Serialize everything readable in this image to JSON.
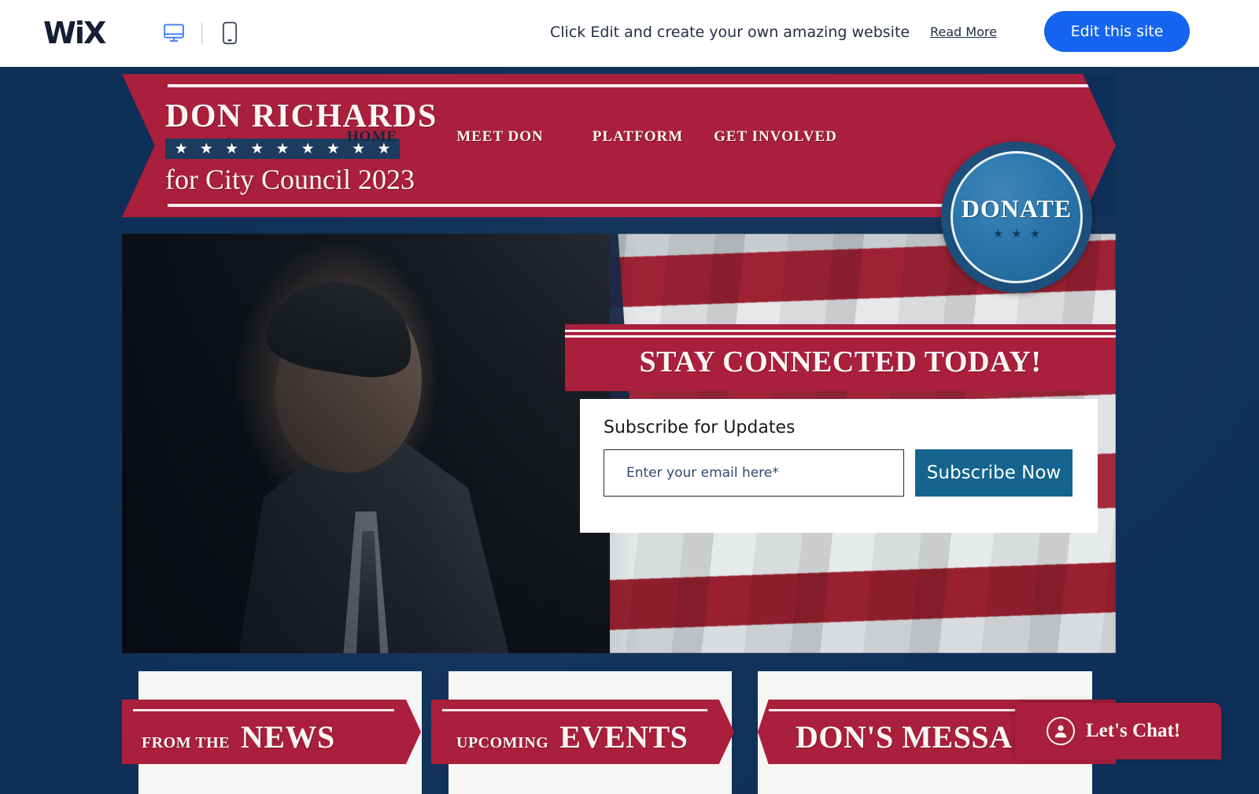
{
  "wix_bar": {
    "logo_text": "WiX",
    "logo_icon": "wix-logo",
    "desktop_icon": "desktop-monitor-icon",
    "mobile_icon": "mobile-phone-icon",
    "message": "Click Edit and create your own amazing website",
    "read_more": "Read More",
    "edit_button": "Edit this site",
    "accent_blue": "#1464f0"
  },
  "site": {
    "colors": {
      "red": "#a91f3c",
      "navy": "#0e2f57",
      "star_bar_navy": "#1d3a5f",
      "seal_blue": "#2a76ab",
      "button_blue": "#14648f",
      "cream": "#fdf7f4"
    },
    "logo": {
      "name": "DON RICHARDS",
      "tagline": "for City Council 2023",
      "star_glyph": "★",
      "star_count": 9
    },
    "nav": {
      "items": [
        {
          "label": "HOME",
          "active": true
        },
        {
          "label": "MEET DON",
          "active": false
        },
        {
          "label": "PLATFORM",
          "active": false
        },
        {
          "label": "GET INVOLVED",
          "active": false
        }
      ]
    },
    "donate": {
      "label": "DONATE",
      "star_glyph": "★",
      "star_count": 3
    },
    "hero": {
      "image_alt": "candidate-portrait-with-american-flag"
    },
    "connect": {
      "title": "STAY CONNECTED TODAY!",
      "subscribe_label": "Subscribe for Updates",
      "email_placeholder": "Enter your email here*",
      "email_value": "",
      "subscribe_button": "Subscribe Now"
    },
    "cards": [
      {
        "eyebrow": "FROM THE",
        "title": "NEWS"
      },
      {
        "eyebrow": "UPCOMING",
        "title": "EVENTS"
      },
      {
        "eyebrow": "",
        "title": "DON'S MESSA"
      }
    ],
    "chat": {
      "label": "Let's Chat!",
      "icon": "person-avatar-icon"
    }
  }
}
